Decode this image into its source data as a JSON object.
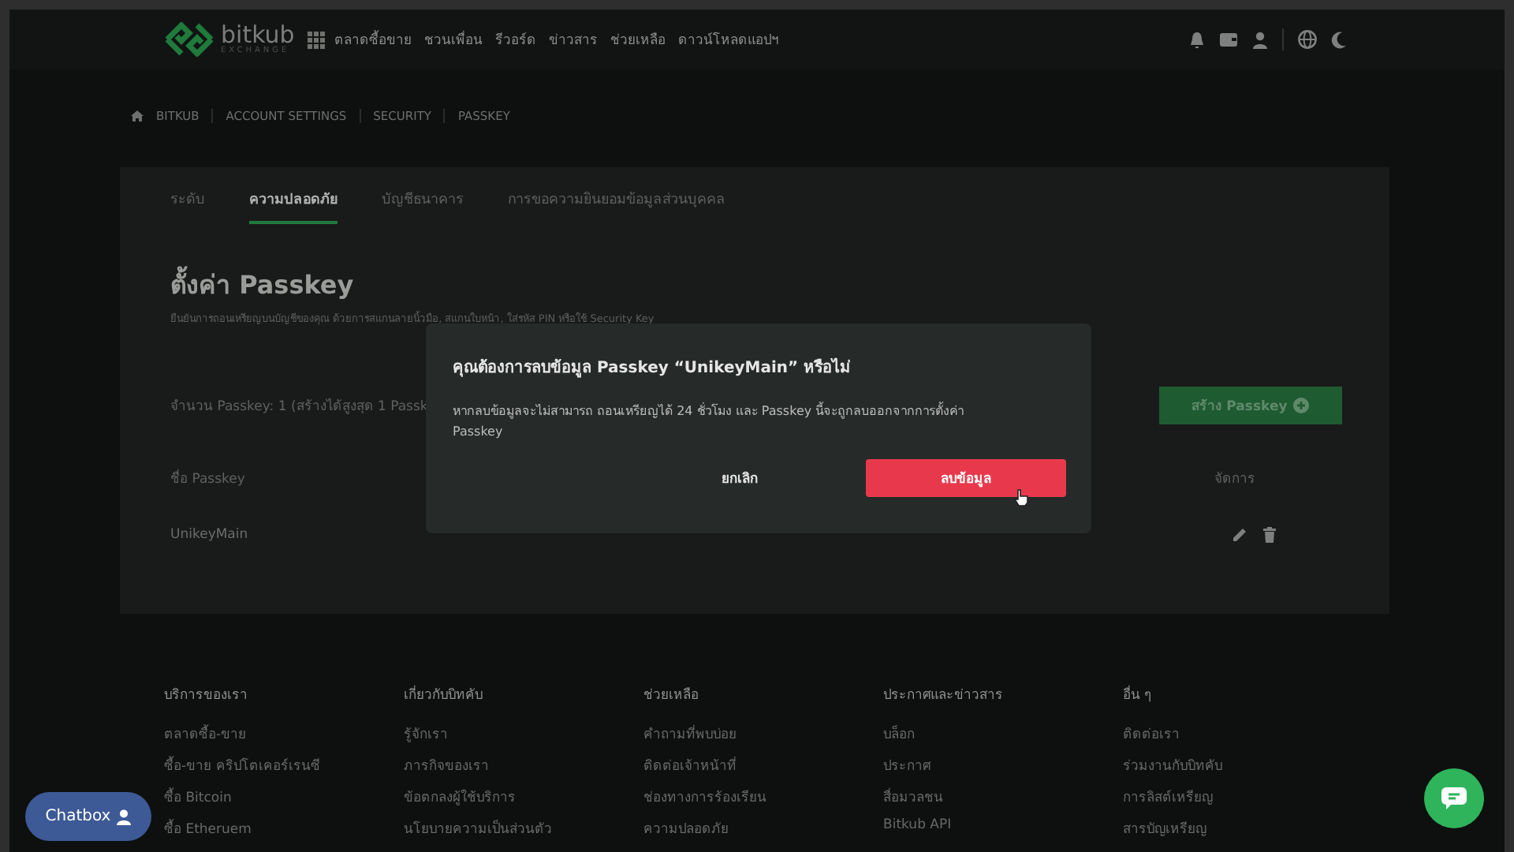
{
  "nav": {
    "logo": {
      "name": "bitkub",
      "tagline": "EXCHANGE"
    },
    "links": [
      "ตลาดซื้อขาย",
      "ชวนเพื่อน",
      "รีวอร์ด",
      "ข่าวสาร",
      "ช่วยเหลือ",
      "ดาวน์โหลดแอปฯ"
    ]
  },
  "breadcrumb": [
    "BITKUB",
    "ACCOUNT SETTINGS",
    "SECURITY",
    "PASSKEY"
  ],
  "tabs": [
    {
      "label": "ระดับ",
      "selected": false
    },
    {
      "label": "ความปลอดภัย",
      "selected": true
    },
    {
      "label": "บัญชีธนาคาร",
      "selected": false
    },
    {
      "label": "การขอความยินยอมข้อมูลส่วนบุคคล",
      "selected": false
    }
  ],
  "page": {
    "title": "ตั้งค่า Passkey",
    "subtitle": "ยืนยันการถอนเหรียญบนบัญชีของคุณ ด้วยการสแกนลายนิ้วมือ, สแกนใบหน้า, ใส่รหัส PIN หรือใช้ Security Key",
    "count": "จำนวน Passkey: 1 (สร้างได้สูงสุด 1 Passk",
    "create_button": "สร้าง Passkey"
  },
  "table": {
    "columns": [
      "ชื่อ Passkey",
      "จัดการ"
    ],
    "rows": [
      {
        "name": "UnikeyMain"
      }
    ]
  },
  "modal": {
    "title": "คุณต้องการลบข้อมูล Passkey “UnikeyMain” หรือไม่",
    "body": "หากลบข้อมูลจะไม่สามารถ ถอนเหรียญได้ 24 ชั่วโมง และ Passkey นี้จะถูกลบออกจากการตั้งค่า Passkey",
    "cancel": "ยกเลิก",
    "confirm": "ลบข้อมูล"
  },
  "footer": [
    {
      "heading": "บริการของเรา",
      "links": [
        "ตลาดซื้อ-ขาย",
        "ซื้อ-ขาย คริปโตเคอร์เรนซี",
        "ซื้อ Bitcoin",
        "ซื้อ Etheruem"
      ]
    },
    {
      "heading": "เกี่ยวกับบิทคับ",
      "links": [
        "รู้จักเรา",
        "ภารกิจของเรา",
        "ข้อตกลงผู้ใช้บริการ",
        "นโยบายความเป็นส่วนตัว"
      ]
    },
    {
      "heading": "ช่วยเหลือ",
      "links": [
        "คำถามที่พบบ่อย",
        "ติดต่อเจ้าหน้าที่",
        "ช่องทางการร้องเรียน",
        "ความปลอดภัย"
      ]
    },
    {
      "heading": "ประกาศและข่าวสาร",
      "links": [
        "บล็อก",
        "ประกาศ",
        "สื่อมวลชน",
        "Bitkub API"
      ]
    },
    {
      "heading": "อื่น ๆ",
      "links": [
        "ติดต่อเรา",
        "ร่วมงานกับบิทคับ",
        "การลิสต์เหรียญ",
        "สารบัญเหรียญ"
      ]
    }
  ],
  "chatbox": {
    "label": "Chatbox"
  }
}
